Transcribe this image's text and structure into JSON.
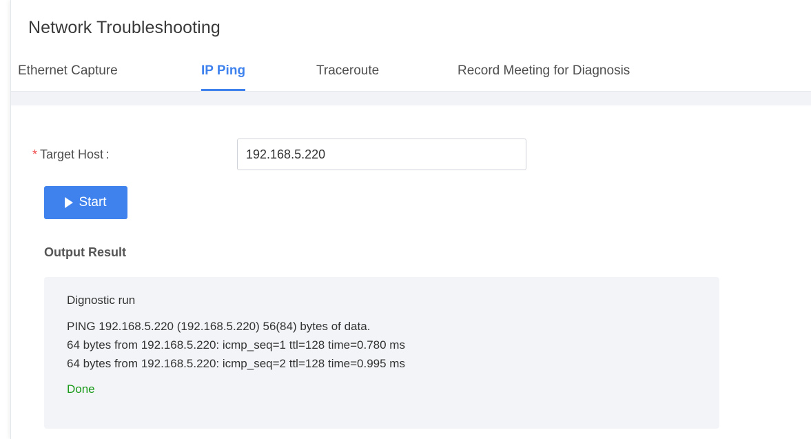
{
  "page": {
    "title": "Network Troubleshooting"
  },
  "tabs": [
    {
      "label": "Ethernet Capture",
      "active": false
    },
    {
      "label": "IP Ping",
      "active": true
    },
    {
      "label": "Traceroute",
      "active": false
    },
    {
      "label": "Record Meeting for Diagnosis",
      "active": false
    }
  ],
  "form": {
    "required_mark": "*",
    "target_host_label": "Target Host :",
    "target_host_value": "192.168.5.220"
  },
  "start_button": {
    "label": "Start",
    "icon": "play-icon"
  },
  "output": {
    "label": "Output Result",
    "heading": "Dignostic run",
    "lines": [
      "PING 192.168.5.220 (192.168.5.220) 56(84) bytes of data.",
      "64 bytes from 192.168.5.220: icmp_seq=1 ttl=128 time=0.780 ms",
      "64 bytes from 192.168.5.220: icmp_seq=2 ttl=128 time=0.995 ms"
    ],
    "status": "Done"
  },
  "colors": {
    "accent": "#3f82ee",
    "required": "#f04848",
    "success": "#1a9a1a",
    "output_background": "#f2f4f7"
  }
}
